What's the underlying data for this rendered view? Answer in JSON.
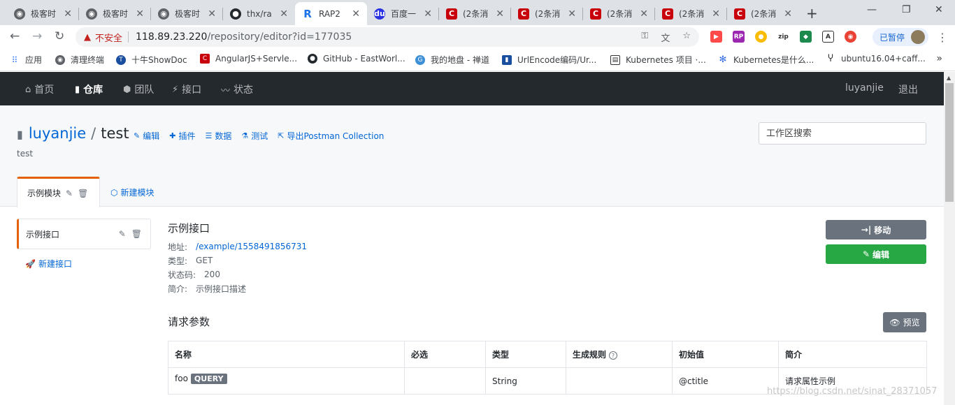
{
  "browser": {
    "tabs": [
      {
        "label": "极客时",
        "icon": "globe-icon",
        "active": false
      },
      {
        "label": "极客时",
        "icon": "globe-icon",
        "active": false
      },
      {
        "label": "极客时",
        "icon": "globe-icon",
        "active": false
      },
      {
        "label": "thx/ra",
        "icon": "github-icon",
        "active": false
      },
      {
        "label": "RAP2",
        "icon": "rap-icon",
        "active": true
      },
      {
        "label": "百度一",
        "icon": "baidu-icon",
        "active": false
      },
      {
        "label": "(2条消",
        "icon": "csdn-icon",
        "active": false
      },
      {
        "label": "(2条消",
        "icon": "csdn-icon",
        "active": false
      },
      {
        "label": "(2条消",
        "icon": "csdn-icon",
        "active": false
      },
      {
        "label": "(2条消",
        "icon": "csdn-icon",
        "active": false
      },
      {
        "label": "(2条消",
        "icon": "csdn-icon",
        "active": false
      }
    ],
    "security_label": "不安全",
    "url_host": "118.89.23.220",
    "url_path": "/repository/editor?id=177035",
    "paused_label": "已暂停",
    "bookmarks": [
      {
        "label": "应用",
        "icon": "apps-icon"
      },
      {
        "label": "清理终端",
        "icon": "globe-icon"
      },
      {
        "label": "十牛ShowDoc",
        "icon": "showdoc-icon"
      },
      {
        "label": "AngularJS+Servle...",
        "icon": "csdn-icon"
      },
      {
        "label": "GitHub - EastWorl...",
        "icon": "github-icon"
      },
      {
        "label": "我的地盘 - 禅道",
        "icon": "zentao-icon"
      },
      {
        "label": "UrlEncode编码/Ur...",
        "icon": "urlencode-icon"
      },
      {
        "label": "Kubernetes 项目 ·...",
        "icon": "book-icon"
      },
      {
        "label": "Kubernetes是什么...",
        "icon": "snowflake-icon"
      },
      {
        "label": "ubuntu16.04+caff...",
        "icon": "arch-icon"
      }
    ]
  },
  "nav": {
    "items": [
      {
        "label": "首页",
        "icon": "home-icon"
      },
      {
        "label": "仓库",
        "icon": "repo-icon"
      },
      {
        "label": "团队",
        "icon": "team-icon"
      },
      {
        "label": "接口",
        "icon": "plug-icon"
      },
      {
        "label": "状态",
        "icon": "pulse-icon"
      }
    ],
    "user": "luyanjie",
    "logout": "退出"
  },
  "repo": {
    "owner": "luyanjie",
    "separator": "/",
    "name": "test",
    "description": "test",
    "actions": [
      {
        "label": "编辑",
        "icon": "pencil-icon"
      },
      {
        "label": "插件",
        "icon": "plugin-icon"
      },
      {
        "label": "数据",
        "icon": "database-icon"
      },
      {
        "label": "测试",
        "icon": "test-icon"
      },
      {
        "label": "导出Postman Collection",
        "icon": "export-icon"
      }
    ],
    "search_placeholder": "工作区搜索"
  },
  "modules": {
    "active_tab": "示例模块",
    "new_label": "新建模块"
  },
  "sidebar": {
    "interface": "示例接口",
    "new_label": "新建接口"
  },
  "interface": {
    "title": "示例接口",
    "url_label": "地址:",
    "url": "/example/1558491856731",
    "type_label": "类型:",
    "type": "GET",
    "status_label": "状态码:",
    "status": "200",
    "desc_label": "简介:",
    "desc": "示例接口描述",
    "move_label": "移动",
    "edit_label": "编辑"
  },
  "params": {
    "title": "请求参数",
    "preview_label": "预览",
    "headers": [
      "名称",
      "必选",
      "类型",
      "生成规则",
      "初始值",
      "简介"
    ],
    "rows": [
      {
        "name": "foo",
        "badge": "QUERY",
        "required": "",
        "type": "String",
        "rule": "",
        "init": "@ctitle",
        "desc": "请求属性示例"
      }
    ]
  },
  "watermark": "https://blog.csdn.net/sinat_28371057",
  "colors": {
    "nav_bg": "#24292e",
    "accent": "#e36209",
    "link": "#0366d6",
    "edit_btn": "#28a745",
    "gray_btn": "#6a737d"
  }
}
